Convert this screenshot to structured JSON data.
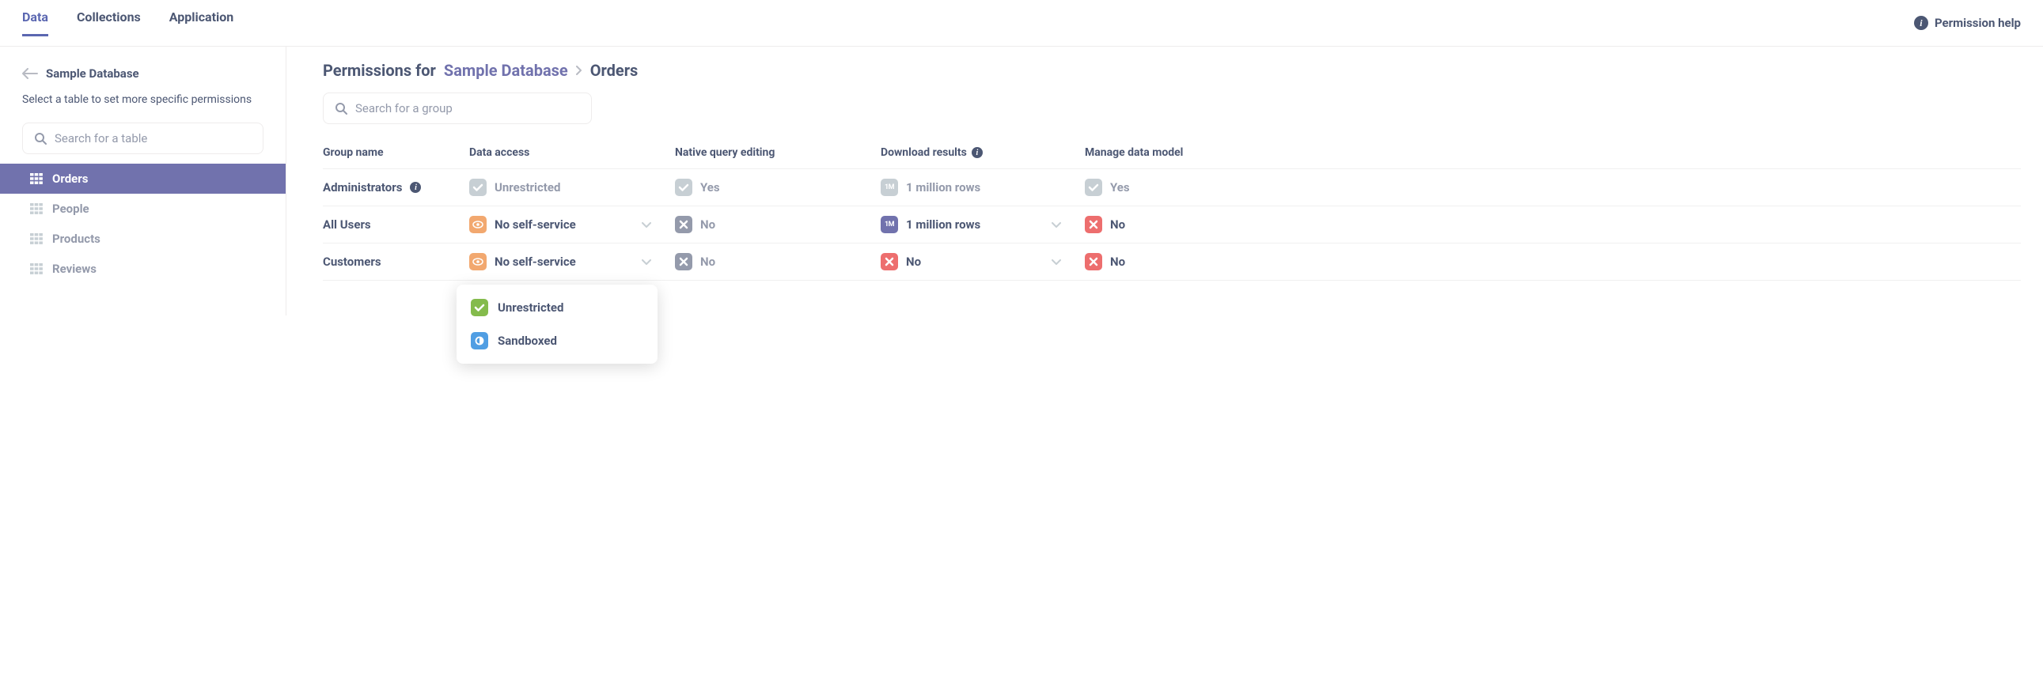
{
  "top_nav": {
    "tabs": [
      {
        "label": "Data",
        "active": true
      },
      {
        "label": "Collections",
        "active": false
      },
      {
        "label": "Application",
        "active": false
      }
    ],
    "help_label": "Permission help"
  },
  "sidebar": {
    "back_label": "Sample Database",
    "hint": "Select a table to set more specific permissions",
    "search_placeholder": "Search for a table",
    "items": [
      {
        "label": "Orders",
        "active": true
      },
      {
        "label": "People",
        "active": false
      },
      {
        "label": "Products",
        "active": false
      },
      {
        "label": "Reviews",
        "active": false
      }
    ]
  },
  "main": {
    "breadcrumb_prefix": "Permissions for",
    "breadcrumb_db": "Sample Database",
    "breadcrumb_table": "Orders",
    "search_placeholder": "Search for a group",
    "columns": {
      "group": "Group name",
      "data_access": "Data access",
      "native": "Native query editing",
      "download": "Download results",
      "manage": "Manage data model"
    },
    "rows": [
      {
        "group": "Administrators",
        "group_info": true,
        "data_access": {
          "label": "Unrestricted",
          "badge": "check-gray",
          "editable": false
        },
        "native": {
          "label": "Yes",
          "badge": "check-gray",
          "editable": false
        },
        "download": {
          "label": "1 million rows",
          "badge": "1m-gray",
          "editable": false
        },
        "manage": {
          "label": "Yes",
          "badge": "check-gray",
          "editable": false
        }
      },
      {
        "group": "All Users",
        "group_info": false,
        "data_access": {
          "label": "No self-service",
          "badge": "eye-orange",
          "editable": true
        },
        "native": {
          "label": "No",
          "badge": "x-gray",
          "editable": false
        },
        "download": {
          "label": "1 million rows",
          "badge": "1m-purple",
          "editable": true
        },
        "manage": {
          "label": "No",
          "badge": "x-red",
          "editable": false
        }
      },
      {
        "group": "Customers",
        "group_info": false,
        "data_access": {
          "label": "No self-service",
          "badge": "eye-orange",
          "editable": true,
          "dropdown_open": true
        },
        "native": {
          "label": "No",
          "badge": "x-gray",
          "editable": false
        },
        "download": {
          "label": "No",
          "badge": "x-red",
          "editable": true
        },
        "manage": {
          "label": "No",
          "badge": "x-red",
          "editable": false
        }
      }
    ],
    "dropdown_options": [
      {
        "label": "Unrestricted",
        "badge": "check-green"
      },
      {
        "label": "Sandboxed",
        "badge": "circle-blue"
      }
    ]
  }
}
